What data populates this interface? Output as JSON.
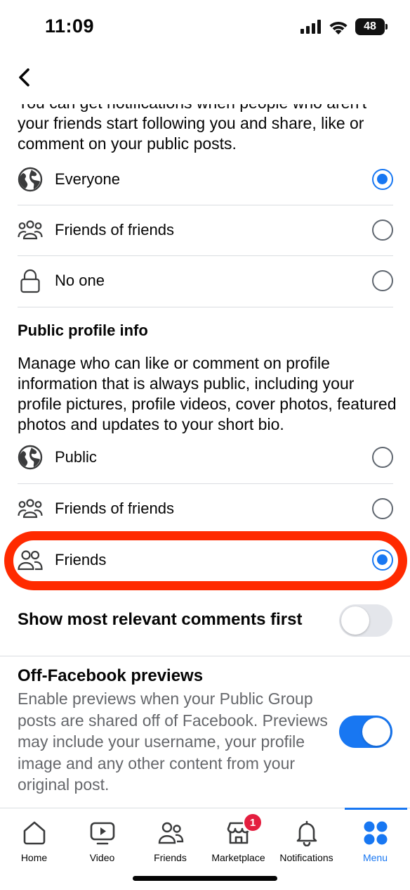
{
  "status_bar": {
    "time": "11:09",
    "battery": "48"
  },
  "followers_section": {
    "description": "You can get notifications when people who aren't your friends start following you and share, like or comment on your public posts.",
    "options": [
      {
        "label": "Everyone",
        "icon": "globe-icon",
        "selected": true
      },
      {
        "label": "Friends of friends",
        "icon": "friends-of-friends-icon",
        "selected": false
      },
      {
        "label": "No one",
        "icon": "lock-icon",
        "selected": false
      }
    ]
  },
  "public_profile_section": {
    "title": "Public profile info",
    "description": "Manage who can like or comment on profile information that is always public, including your profile pictures, profile videos, cover photos, featured photos and updates to your short bio.",
    "options": [
      {
        "label": "Public",
        "icon": "globe-icon",
        "selected": false
      },
      {
        "label": "Friends of friends",
        "icon": "friends-of-friends-icon",
        "selected": false
      },
      {
        "label": "Friends",
        "icon": "friends-icon",
        "selected": true
      }
    ]
  },
  "relevant_comments": {
    "label": "Show most relevant comments first",
    "enabled": false
  },
  "off_facebook_previews": {
    "title": "Off-Facebook previews",
    "description": "Enable previews when your Public Group posts are shared off of Facebook. Previews may include your username, your profile image and any other content from your original post.",
    "enabled": true
  },
  "tab_bar": {
    "tabs": [
      {
        "label": "Home",
        "icon": "home-icon",
        "active": false
      },
      {
        "label": "Video",
        "icon": "video-icon",
        "active": false
      },
      {
        "label": "Friends",
        "icon": "friends-icon",
        "active": false
      },
      {
        "label": "Marketplace",
        "icon": "marketplace-icon",
        "active": false,
        "badge": "1"
      },
      {
        "label": "Notifications",
        "icon": "bell-icon",
        "active": false
      },
      {
        "label": "Menu",
        "icon": "menu-grid-icon",
        "active": true
      }
    ]
  },
  "colors": {
    "accent": "#1877f2",
    "highlight": "#ff2a00",
    "badge": "#e41e3f",
    "secondary_text": "#65676b"
  }
}
